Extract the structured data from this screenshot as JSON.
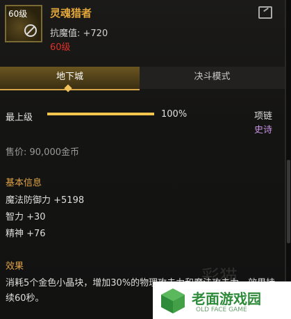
{
  "item": {
    "level_badge": "60级",
    "name": "灵魂猎者",
    "stat": "抗魔值: +720",
    "required_level": "60级"
  },
  "tabs": [
    {
      "label": "地下城",
      "active": true
    },
    {
      "label": "决斗模式",
      "active": false
    }
  ],
  "grade": {
    "label": "最上级",
    "progress": 1.0,
    "percent_text": "100%",
    "slot": "项链",
    "rarity": "史诗"
  },
  "price": "售价: 90,000金币",
  "basic_info": {
    "title": "基本信息",
    "lines": [
      "魔法防御力 +5198",
      "智力 +30",
      "精神 +76"
    ]
  },
  "effect": {
    "title": "效果",
    "text": "消耗5个金色小晶块，增加30%的物理攻击力和魔法攻击力，效果持续60秒。"
  },
  "watermark": {
    "script_text": "彩猫",
    "logo_name": "老面游戏园",
    "logo_sub": "OLD FACE GAME"
  },
  "colors": {
    "title": "#e4a73a",
    "required_level": "#e0302a",
    "rarity": "#c793e2",
    "section": "#e0a348",
    "bar_fill": "#f3c54c"
  }
}
